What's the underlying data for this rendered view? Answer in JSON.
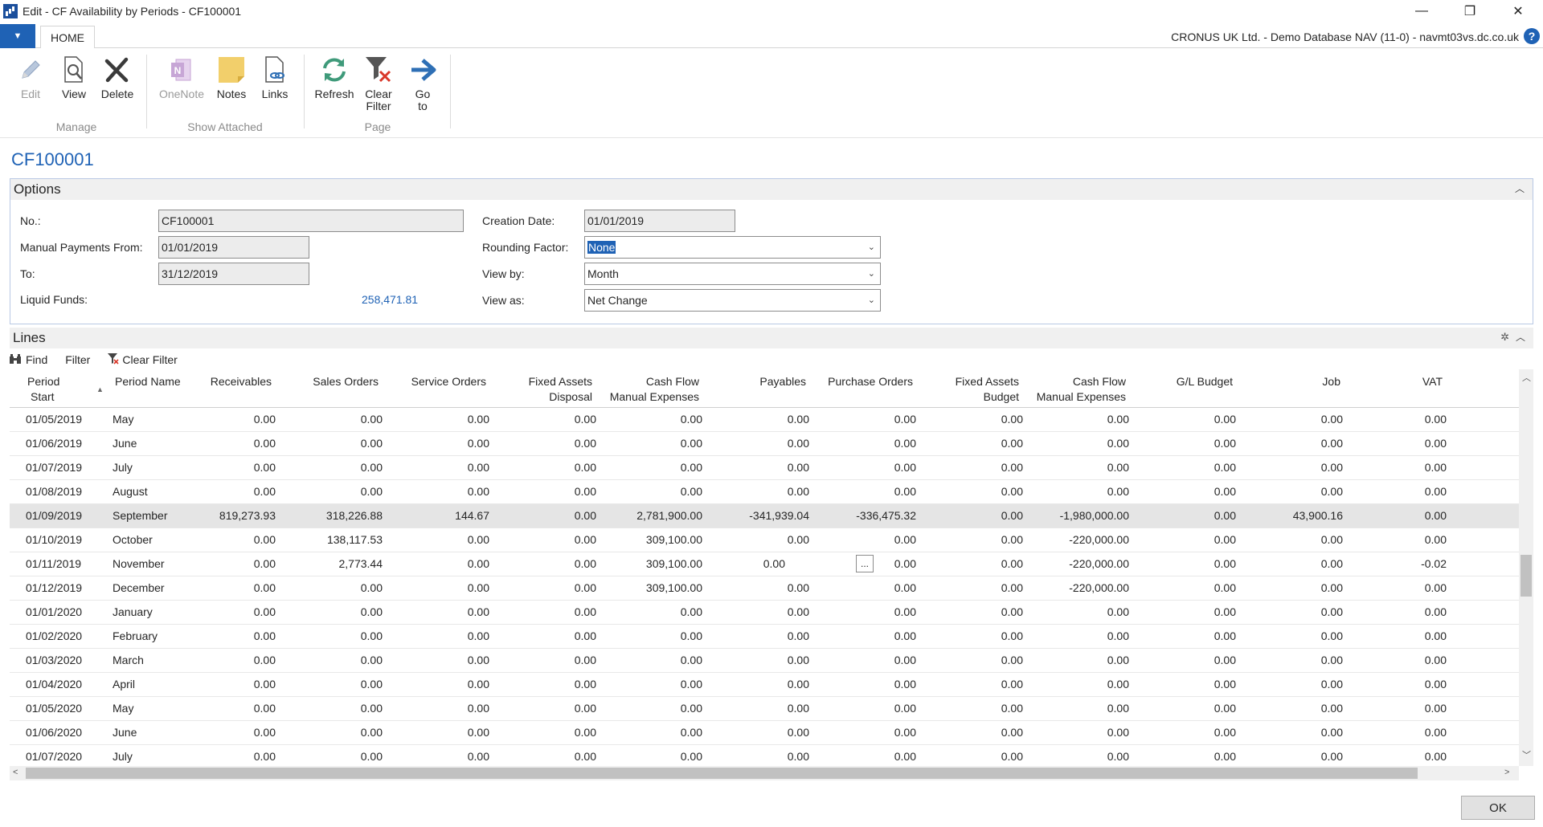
{
  "window": {
    "title": "Edit - CF Availability by Periods - CF100001",
    "minimize": "—",
    "restore": "❐",
    "close": "✕"
  },
  "ribbon": {
    "file_glyph": "▼",
    "home_tab": "HOME",
    "company": "CRONUS UK Ltd. - Demo Database NAV (11-0) - navmt03vs.dc.co.uk",
    "help": "?",
    "groups": {
      "manage": "Manage",
      "show_attached": "Show Attached",
      "page": "Page"
    },
    "buttons": {
      "edit": "Edit",
      "view": "View",
      "delete": "Delete",
      "onenote": "OneNote",
      "notes": "Notes",
      "links": "Links",
      "refresh": "Refresh",
      "clear_filter_1": "Clear",
      "clear_filter_2": "Filter",
      "goto_1": "Go",
      "goto_2": "to"
    }
  },
  "page_title": "CF100001",
  "options": {
    "header": "Options",
    "no_label": "No.:",
    "no_value": "CF100001",
    "manual_from_label": "Manual Payments From:",
    "manual_from_value": "01/01/2019",
    "to_label": "To:",
    "to_value": "31/12/2019",
    "liquid_label": "Liquid Funds:",
    "liquid_value": "258,471.81",
    "creation_label": "Creation Date:",
    "creation_value": "01/01/2019",
    "rounding_label": "Rounding Factor:",
    "rounding_value": "None",
    "viewby_label": "View by:",
    "viewby_value": "Month",
    "viewas_label": "View as:",
    "viewas_value": "Net Change"
  },
  "lines": {
    "header": "Lines",
    "toolbar": {
      "find": "Find",
      "filter": "Filter",
      "clear_filter": "Clear Filter"
    },
    "columns": [
      [
        "Period",
        "Start"
      ],
      [
        "Period Name",
        ""
      ],
      [
        "Receivables",
        ""
      ],
      [
        "Sales Orders",
        ""
      ],
      [
        "Service Orders",
        ""
      ],
      [
        "Fixed Assets",
        "Disposal"
      ],
      [
        "Cash Flow",
        "Manual Expenses"
      ],
      [
        "Payables",
        ""
      ],
      [
        "Purchase Orders",
        ""
      ],
      [
        "Fixed Assets",
        "Budget"
      ],
      [
        "Cash Flow",
        "Manual Expenses"
      ],
      [
        "G/L Budget",
        ""
      ],
      [
        "Job",
        ""
      ],
      [
        "VAT",
        ""
      ]
    ],
    "rows": [
      [
        "01/05/2019",
        "May",
        "0.00",
        "0.00",
        "0.00",
        "0.00",
        "0.00",
        "0.00",
        "0.00",
        "0.00",
        "0.00",
        "0.00",
        "0.00",
        "0.00"
      ],
      [
        "01/06/2019",
        "June",
        "0.00",
        "0.00",
        "0.00",
        "0.00",
        "0.00",
        "0.00",
        "0.00",
        "0.00",
        "0.00",
        "0.00",
        "0.00",
        "0.00"
      ],
      [
        "01/07/2019",
        "July",
        "0.00",
        "0.00",
        "0.00",
        "0.00",
        "0.00",
        "0.00",
        "0.00",
        "0.00",
        "0.00",
        "0.00",
        "0.00",
        "0.00"
      ],
      [
        "01/08/2019",
        "August",
        "0.00",
        "0.00",
        "0.00",
        "0.00",
        "0.00",
        "0.00",
        "0.00",
        "0.00",
        "0.00",
        "0.00",
        "0.00",
        "0.00"
      ],
      [
        "01/09/2019",
        "September",
        "819,273.93",
        "318,226.88",
        "144.67",
        "0.00",
        "2,781,900.00",
        "-341,939.04",
        "-336,475.32",
        "0.00",
        "-1,980,000.00",
        "0.00",
        "43,900.16",
        "0.00"
      ],
      [
        "01/10/2019",
        "October",
        "0.00",
        "138,117.53",
        "0.00",
        "0.00",
        "309,100.00",
        "0.00",
        "0.00",
        "0.00",
        "-220,000.00",
        "0.00",
        "0.00",
        "0.00"
      ],
      [
        "01/11/2019",
        "November",
        "0.00",
        "2,773.44",
        "0.00",
        "0.00",
        "309,100.00",
        "0.00",
        "0.00",
        "0.00",
        "-220,000.00",
        "0.00",
        "0.00",
        "-0.02"
      ],
      [
        "01/12/2019",
        "December",
        "0.00",
        "0.00",
        "0.00",
        "0.00",
        "309,100.00",
        "0.00",
        "0.00",
        "0.00",
        "-220,000.00",
        "0.00",
        "0.00",
        "0.00"
      ],
      [
        "01/01/2020",
        "January",
        "0.00",
        "0.00",
        "0.00",
        "0.00",
        "0.00",
        "0.00",
        "0.00",
        "0.00",
        "0.00",
        "0.00",
        "0.00",
        "0.00"
      ],
      [
        "01/02/2020",
        "February",
        "0.00",
        "0.00",
        "0.00",
        "0.00",
        "0.00",
        "0.00",
        "0.00",
        "0.00",
        "0.00",
        "0.00",
        "0.00",
        "0.00"
      ],
      [
        "01/03/2020",
        "March",
        "0.00",
        "0.00",
        "0.00",
        "0.00",
        "0.00",
        "0.00",
        "0.00",
        "0.00",
        "0.00",
        "0.00",
        "0.00",
        "0.00"
      ],
      [
        "01/04/2020",
        "April",
        "0.00",
        "0.00",
        "0.00",
        "0.00",
        "0.00",
        "0.00",
        "0.00",
        "0.00",
        "0.00",
        "0.00",
        "0.00",
        "0.00"
      ],
      [
        "01/05/2020",
        "May",
        "0.00",
        "0.00",
        "0.00",
        "0.00",
        "0.00",
        "0.00",
        "0.00",
        "0.00",
        "0.00",
        "0.00",
        "0.00",
        "0.00"
      ],
      [
        "01/06/2020",
        "June",
        "0.00",
        "0.00",
        "0.00",
        "0.00",
        "0.00",
        "0.00",
        "0.00",
        "0.00",
        "0.00",
        "0.00",
        "0.00",
        "0.00"
      ],
      [
        "01/07/2020",
        "July",
        "0.00",
        "0.00",
        "0.00",
        "0.00",
        "0.00",
        "0.00",
        "0.00",
        "0.00",
        "0.00",
        "0.00",
        "0.00",
        "0.00"
      ]
    ],
    "selected_row": 4,
    "ellipsis_row": 6,
    "ellipsis_label": "..."
  },
  "ok_button": "OK",
  "colors": {
    "accent": "#1f62b5",
    "selected_row": "#e5e5e5",
    "field_bg": "#ececec"
  },
  "icons": {
    "find": "binoculars-icon",
    "clear_filter": "clear-filter-icon",
    "settings": "settings-icon",
    "collapse": "collapse-icon"
  }
}
